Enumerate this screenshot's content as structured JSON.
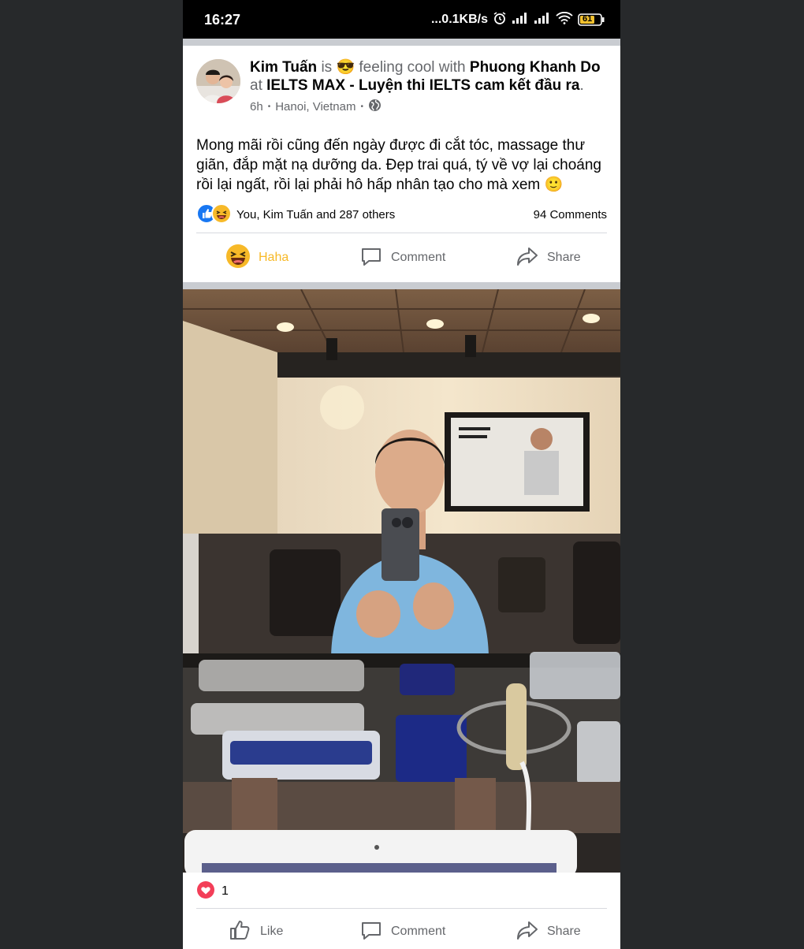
{
  "status_bar": {
    "time": "16:27",
    "network_speed": "...0.1KB/s",
    "battery": "61"
  },
  "post": {
    "author": "Kim Tuấn",
    "is_text": "is",
    "feeling_emoji": "😎",
    "feeling_text": "feeling cool with",
    "tagged": "Phuong Khanh Do",
    "at_text": "at",
    "place": "IELTS MAX - Luyện thi IELTS cam kết đầu ra",
    "place_end": ".",
    "time": "6h",
    "dot": "•",
    "location": "Hanoi, Vietnam",
    "privacy_icon": "globe-icon",
    "caption": "Mong mãi rồi cũng đến ngày được đi cắt tóc, massage thư giãn, đắp mặt nạ dưỡng da. Đẹp trai quá, tý về vợ lại choáng rồi lại ngất, rồi lại phải hô hấp nhân tạo cho mà xem",
    "caption_emoji": "🙂",
    "reactors": "You, Kim Tuấn and 287 others",
    "comments_count": "94 Comments",
    "actions": {
      "reacted": "Haha",
      "comment": "Comment",
      "share": "Share"
    }
  },
  "photo": {
    "description_icon": "selfie-photo",
    "reaction_count": "1",
    "actions": {
      "like": "Like",
      "comment": "Comment",
      "share": "Share"
    }
  },
  "colors": {
    "haha_yellow": "#f7b928",
    "like_blue": "#1877f2",
    "love_red": "#f33e58",
    "secondary_text": "#65676b"
  }
}
